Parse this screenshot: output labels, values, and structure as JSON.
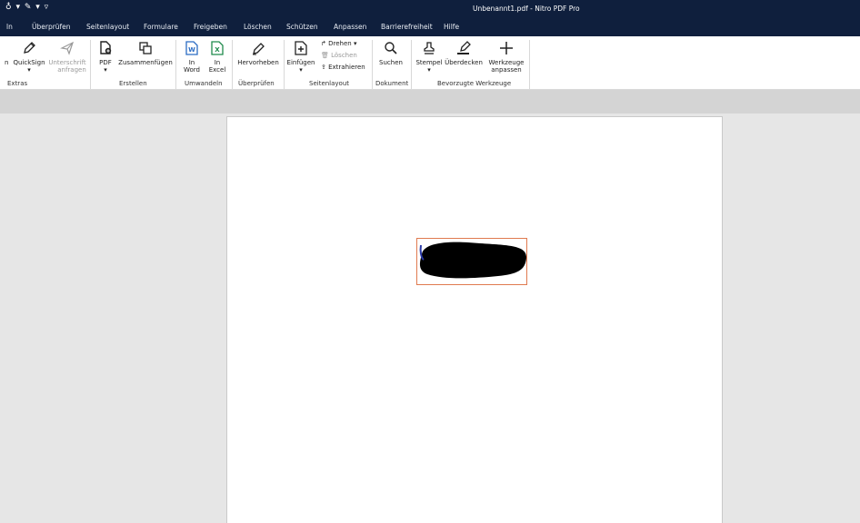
{
  "titlebar": {
    "quick_access": "♁ ▾ ✎ ▾ ▿",
    "title": "Unbenannt1.pdf - Nitro PDF Pro"
  },
  "menu": [
    "ln",
    "Überprüfen",
    "Seitenlayout",
    "Formulare",
    "Freigeben",
    "Löschen",
    "Schützen",
    "Anpassen",
    "Barrierefreiheit",
    "Hilfe"
  ],
  "ribbon": {
    "cut_off_left": "n",
    "quicksign": "QuickSign",
    "unterschrift_line1": "Unterschrift",
    "unterschrift_line2": "anfragen",
    "pdf": "PDF",
    "zusammenfuegen": "Zusammenfügen",
    "in_word_line1": "In",
    "in_word_line2": "Word",
    "in_excel_line1": "In",
    "in_excel_line2": "Excel",
    "hervorheben": "Hervorheben",
    "einfuegen": "Einfügen",
    "drehen": "Drehen",
    "loeschen": "Löschen",
    "extrahieren": "Extrahieren",
    "suchen": "Suchen",
    "stempel": "Stempel",
    "ueberdecken": "Überdecken",
    "werkzeuge_line1": "Werkzeuge",
    "werkzeuge_line2": "anpassen",
    "groups": {
      "extras": "Extras",
      "erstellen": "Erstellen",
      "umwandeln": "Umwandeln",
      "ueberpruefen": "Überprüfen",
      "seitenlayout": "Seitenlayout",
      "dokument": "Dokument",
      "bevorzugte": "Bevorzugte Werkzeuge"
    }
  },
  "colors": {
    "titlebar_bg": "#0f1f3d",
    "word_icon": "#2b6cc4",
    "excel_icon": "#1f8a4c",
    "selection_border": "#e07a4f"
  }
}
